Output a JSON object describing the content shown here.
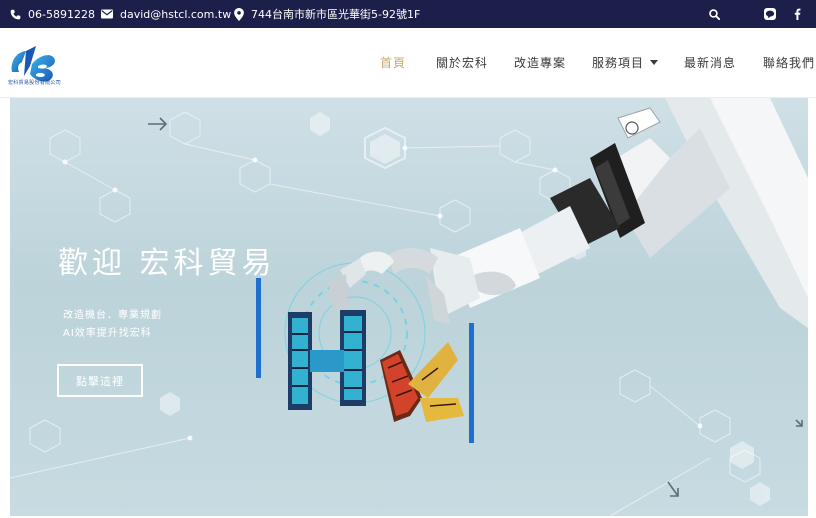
{
  "topbar": {
    "phone": "06-5891228",
    "email": "david@hstcl.com.tw",
    "address": "744台南市新市區光華街5-92號1F"
  },
  "brand": {
    "logo_caption": "宏科貿易股份有限公司"
  },
  "nav": {
    "items": [
      {
        "label": "首頁",
        "active": true
      },
      {
        "label": "關於宏科"
      },
      {
        "label": "改造專案"
      },
      {
        "label": "服務項目",
        "has_dropdown": true
      },
      {
        "label": "最新消息"
      },
      {
        "label": "聯絡我們"
      }
    ]
  },
  "hero": {
    "title": "歡迎 宏科貿易",
    "line1": "改造機台．專業規劃",
    "line2": "AI效率提升找宏科",
    "cta": "點擊這裡"
  },
  "colors": {
    "topbar": "#1c1f4a",
    "active_nav": "#c9a86a",
    "accent_blue": "#1f6fd1"
  }
}
